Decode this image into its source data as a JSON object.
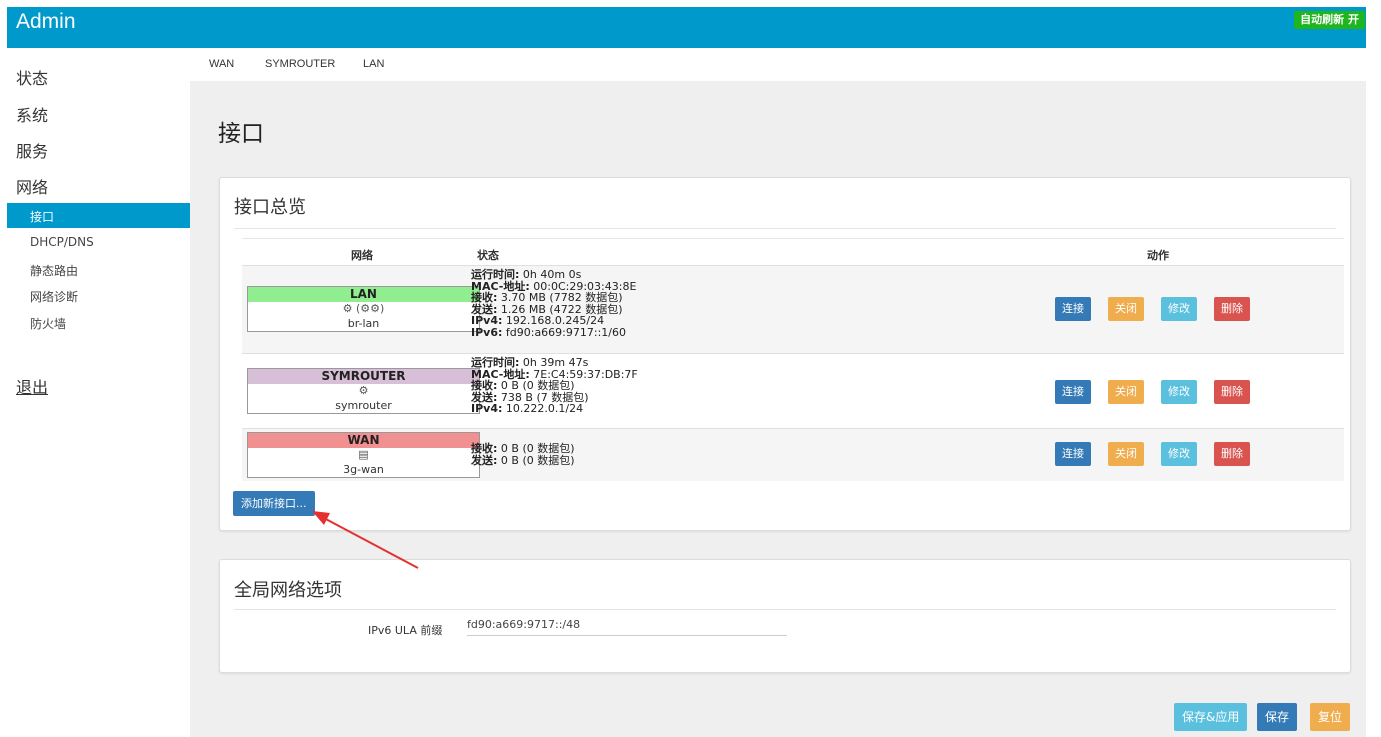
{
  "header": {
    "brand": "Admin",
    "autorefresh": "自动刷新 开"
  },
  "sidebar": {
    "top_items": [
      "状态",
      "系统",
      "服务",
      "网络"
    ],
    "network_items": [
      "接口",
      "DHCP/DNS",
      "静态路由",
      "网络诊断",
      "防火墙"
    ],
    "logout": "退出"
  },
  "tabs": [
    "WAN",
    "SYMROUTER",
    "LAN"
  ],
  "page": {
    "title": "接口"
  },
  "overview": {
    "title": "接口总览",
    "columns": {
      "network": "网络",
      "status": "状态",
      "actions": "动作"
    },
    "rows": [
      {
        "name": "LAN",
        "color": "#90ee90",
        "icons": "⚙ (⚙⚙)",
        "device": "br-lan",
        "status": [
          {
            "k": "运行时间:",
            "v": " 0h 40m 0s"
          },
          {
            "k": "MAC-地址:",
            "v": " 00:0C:29:03:43:8E"
          },
          {
            "k": "接收:",
            "v": " 3.70 MB (7782 数据包)"
          },
          {
            "k": "发送:",
            "v": " 1.26 MB (4722 数据包)"
          },
          {
            "k": "IPv4:",
            "v": " 192.168.0.245/24"
          },
          {
            "k": "IPv6:",
            "v": " fd90:a669:9717::1/60"
          }
        ]
      },
      {
        "name": "SYMROUTER",
        "color": "#d8bfd8",
        "icons": "⚙",
        "device": "symrouter",
        "status": [
          {
            "k": "运行时间:",
            "v": " 0h 39m 47s"
          },
          {
            "k": "MAC-地址:",
            "v": " 7E:C4:59:37:DB:7F"
          },
          {
            "k": "接收:",
            "v": " 0 B (0 数据包)"
          },
          {
            "k": "发送:",
            "v": " 738 B (7 数据包)"
          },
          {
            "k": "IPv4:",
            "v": " 10.222.0.1/24"
          }
        ]
      },
      {
        "name": "WAN",
        "color": "#f09090",
        "icons": "▤",
        "device": "3g-wan",
        "status": [
          {
            "k": "接收:",
            "v": " 0 B (0 数据包)"
          },
          {
            "k": "发送:",
            "v": " 0 B (0 数据包)"
          }
        ]
      }
    ],
    "buttons": {
      "connect": "连接",
      "stop": "关闭",
      "edit": "修改",
      "delete": "删除"
    },
    "add_button": "添加新接口..."
  },
  "global": {
    "title": "全局网络选项",
    "ula_label": "IPv6 ULA 前缀",
    "ula_value": "fd90:a669:9717::/48"
  },
  "footer": {
    "save_apply": "保存&应用",
    "save": "保存",
    "reset": "复位"
  },
  "colors": {
    "accent": "#0099cc",
    "green": "#1fb51f"
  }
}
